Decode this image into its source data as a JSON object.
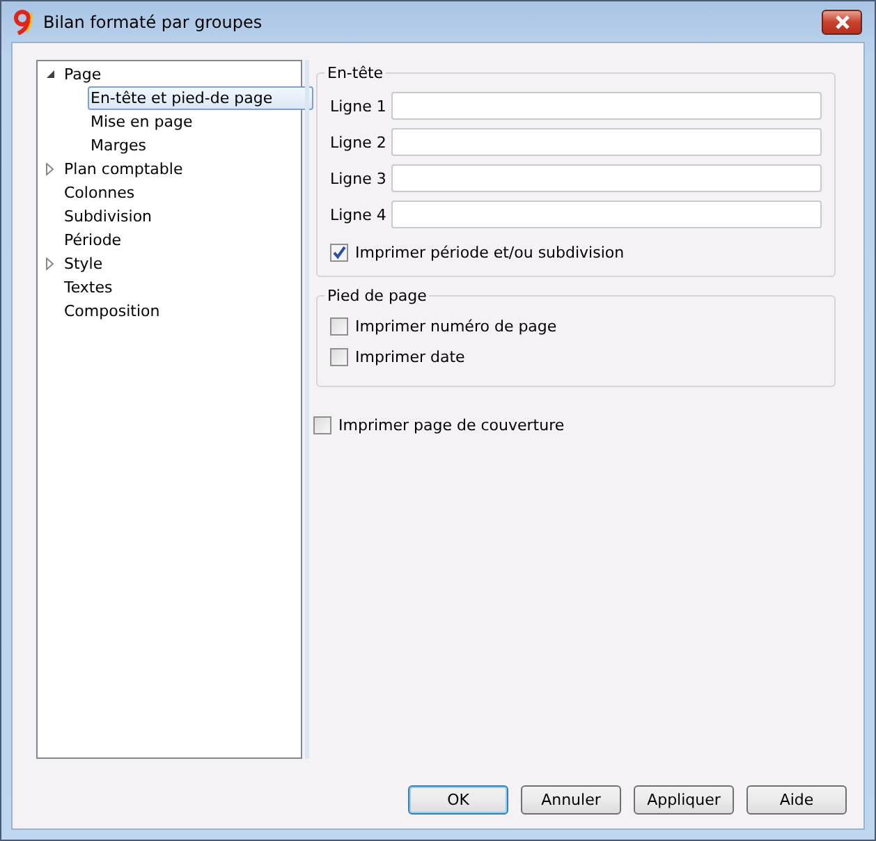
{
  "window": {
    "title": "Bilan formaté par groupes"
  },
  "tree": [
    {
      "label": "Page",
      "selected": false,
      "expanded": true,
      "children": [
        {
          "label": "En-tête et pied-de page",
          "selected": true
        },
        {
          "label": "Mise en page",
          "selected": false
        },
        {
          "label": "Marges",
          "selected": false
        }
      ]
    },
    {
      "label": "Plan comptable",
      "selected": false,
      "expanded": false
    },
    {
      "label": "Colonnes",
      "selected": false
    },
    {
      "label": "Subdivision",
      "selected": false
    },
    {
      "label": "Période",
      "selected": false
    },
    {
      "label": "Style",
      "selected": false,
      "expanded": false
    },
    {
      "label": "Textes",
      "selected": false
    },
    {
      "label": "Composition",
      "selected": false
    }
  ],
  "header_group": {
    "title": "En-tête",
    "lines": [
      {
        "label": "Ligne 1"
      },
      {
        "label": "Ligne 2"
      },
      {
        "label": "Ligne 3"
      },
      {
        "label": "Ligne 4"
      }
    ],
    "checkboxes": [
      {
        "label": "Imprimer période et/ou subdivision",
        "checked": true
      }
    ]
  },
  "footer_group": {
    "title": "Pied de page",
    "checkboxes": [
      {
        "label": "Imprimer numéro de page",
        "checked": false
      },
      {
        "label": "Imprimer date",
        "checked": false
      }
    ]
  },
  "cover_checkbox": {
    "label": "Imprimer page de couverture",
    "checked": false
  },
  "buttons": [
    {
      "label": "OK",
      "default": true
    },
    {
      "label": "Annuler",
      "default": false
    },
    {
      "label": "Appliquer",
      "default": false
    },
    {
      "label": "Aide",
      "default": false
    }
  ]
}
